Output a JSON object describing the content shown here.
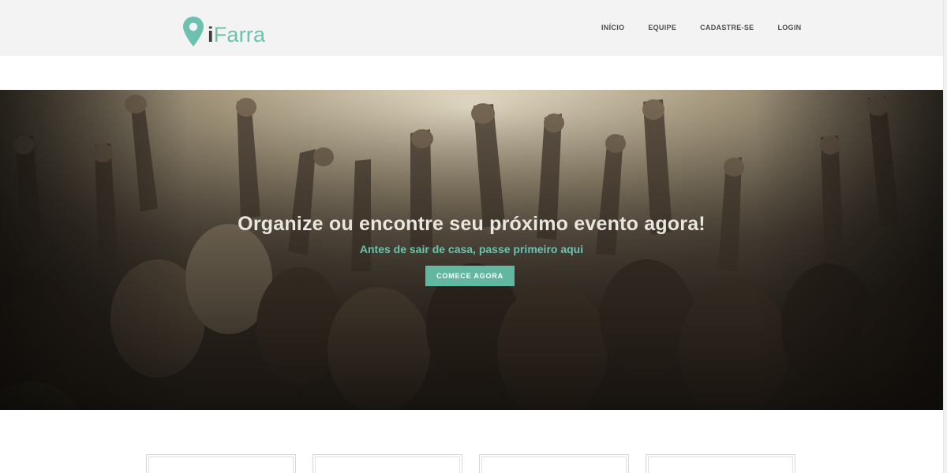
{
  "brand": {
    "prefix": "i",
    "name": "Farra",
    "accent": "#6cc2ae"
  },
  "nav": {
    "items": [
      {
        "label": "INÍCIO"
      },
      {
        "label": "EQUIPE"
      },
      {
        "label": "CADASTRE-SE"
      },
      {
        "label": "LOGIN"
      }
    ]
  },
  "hero": {
    "title": "Organize ou encontre seu próximo evento agora!",
    "subtitle": "Antes de sair de casa, passe primeiro aqui",
    "cta_label": "COMECE AGORA",
    "cta_color": "#61b7a0"
  },
  "cards": [
    {},
    {},
    {},
    {}
  ]
}
